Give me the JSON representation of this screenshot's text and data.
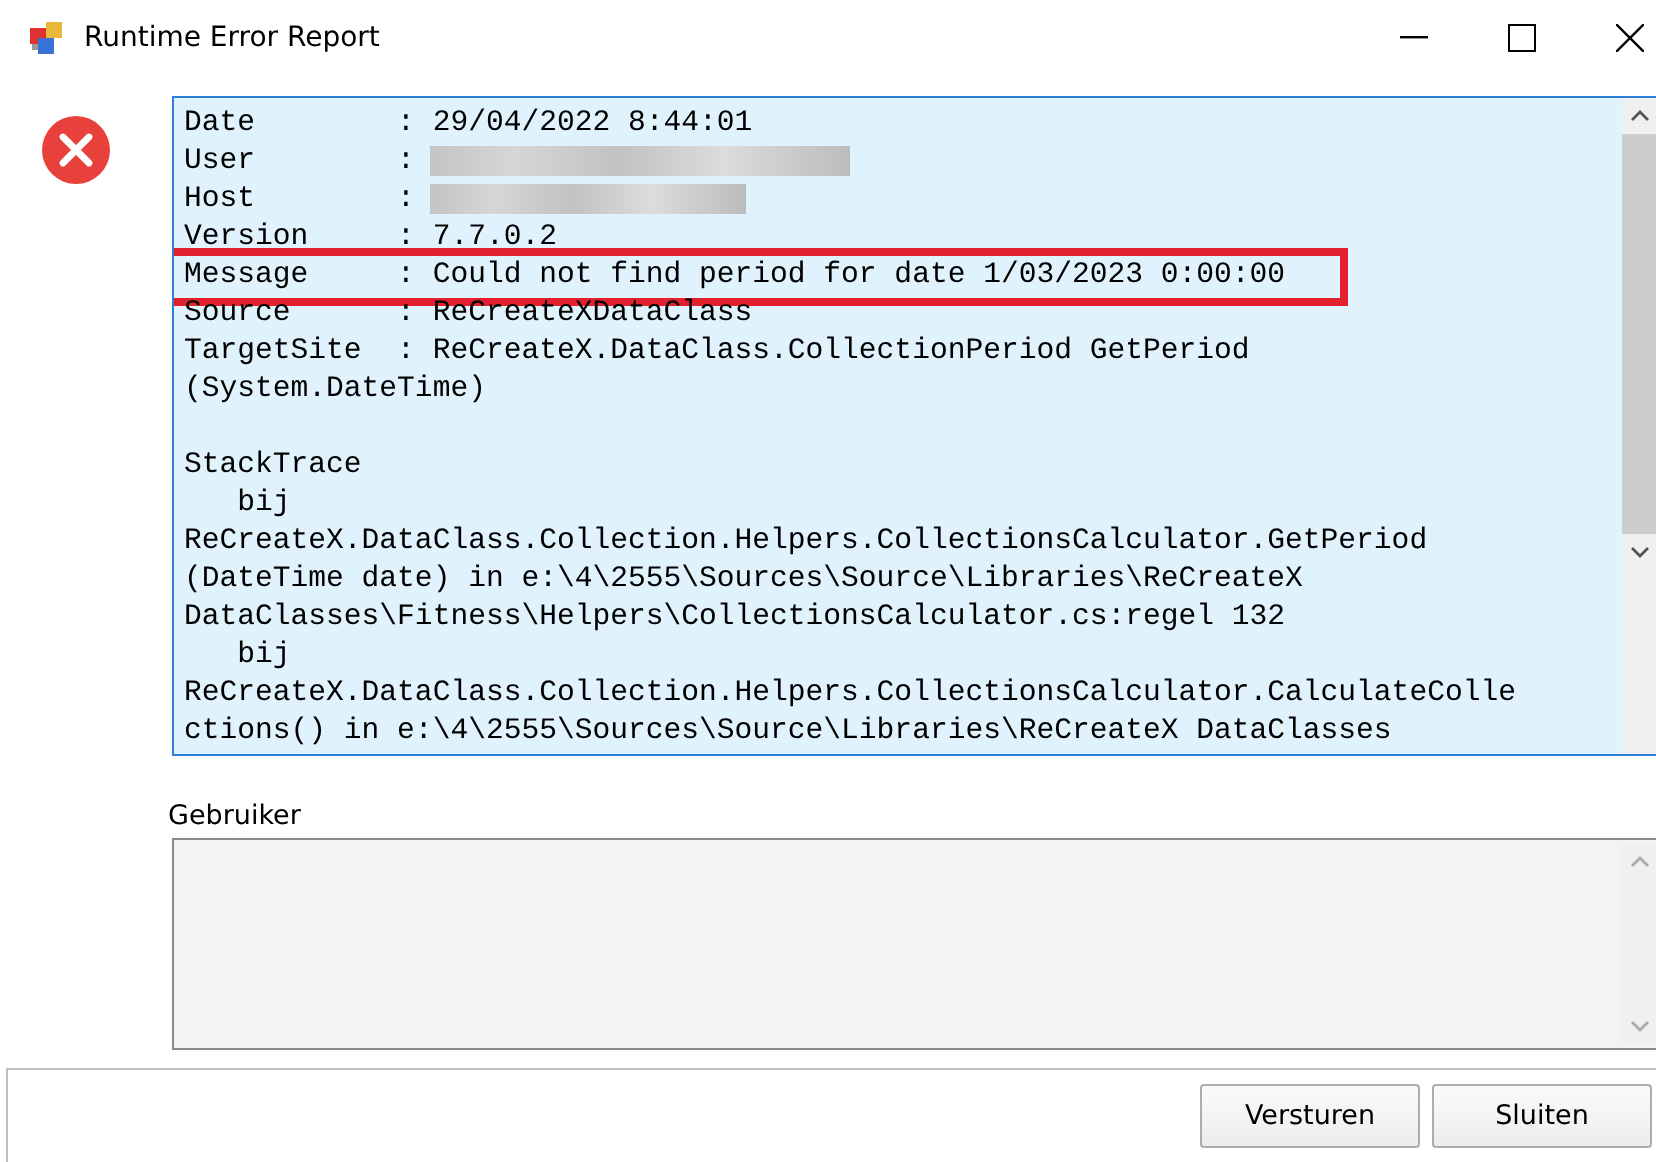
{
  "window": {
    "title": "Runtime Error Report"
  },
  "report": {
    "lines": [
      {
        "kind": "text",
        "text": "Date        : 29/04/2022 8:44:01",
        "highlighted": false
      },
      {
        "kind": "redacted",
        "text": "User        :",
        "highlighted": false
      },
      {
        "kind": "redacted",
        "text": "Host        :",
        "highlighted": false
      },
      {
        "kind": "text",
        "text": "Version     : 7.7.0.2",
        "highlighted": false
      },
      {
        "kind": "text",
        "text": "Message     : Could not find period for date 1/03/2023 0:00:00",
        "highlighted": true
      },
      {
        "kind": "text",
        "text": "Source      : ReCreateXDataClass",
        "highlighted": false
      },
      {
        "kind": "text",
        "text": "TargetSite  : ReCreateX.DataClass.CollectionPeriod GetPeriod",
        "highlighted": false
      },
      {
        "kind": "text",
        "text": "(System.DateTime)",
        "highlighted": false
      },
      {
        "kind": "blank"
      },
      {
        "kind": "text",
        "text": "StackTrace",
        "highlighted": false
      },
      {
        "kind": "text",
        "text": "   bij",
        "highlighted": false
      },
      {
        "kind": "text",
        "text": "ReCreateX.DataClass.Collection.Helpers.CollectionsCalculator.GetPeriod",
        "highlighted": false
      },
      {
        "kind": "text",
        "text": "(DateTime date) in e:\\4\\2555\\Sources\\Source\\Libraries\\ReCreateX",
        "highlighted": false
      },
      {
        "kind": "text",
        "text": "DataClasses\\Fitness\\Helpers\\CollectionsCalculator.cs:regel 132",
        "highlighted": false
      },
      {
        "kind": "text",
        "text": "   bij",
        "highlighted": false
      },
      {
        "kind": "text",
        "text": "ReCreateX.DataClass.Collection.Helpers.CollectionsCalculator.CalculateColle",
        "highlighted": false
      },
      {
        "kind": "text",
        "text": "ctions() in e:\\4\\2555\\Sources\\Source\\Libraries\\ReCreateX DataClasses",
        "highlighted": false
      }
    ]
  },
  "user_comment": {
    "label": "Gebruiker"
  },
  "buttons": [
    {
      "label": "Versturen"
    },
    {
      "label": "Sluiten"
    }
  ]
}
